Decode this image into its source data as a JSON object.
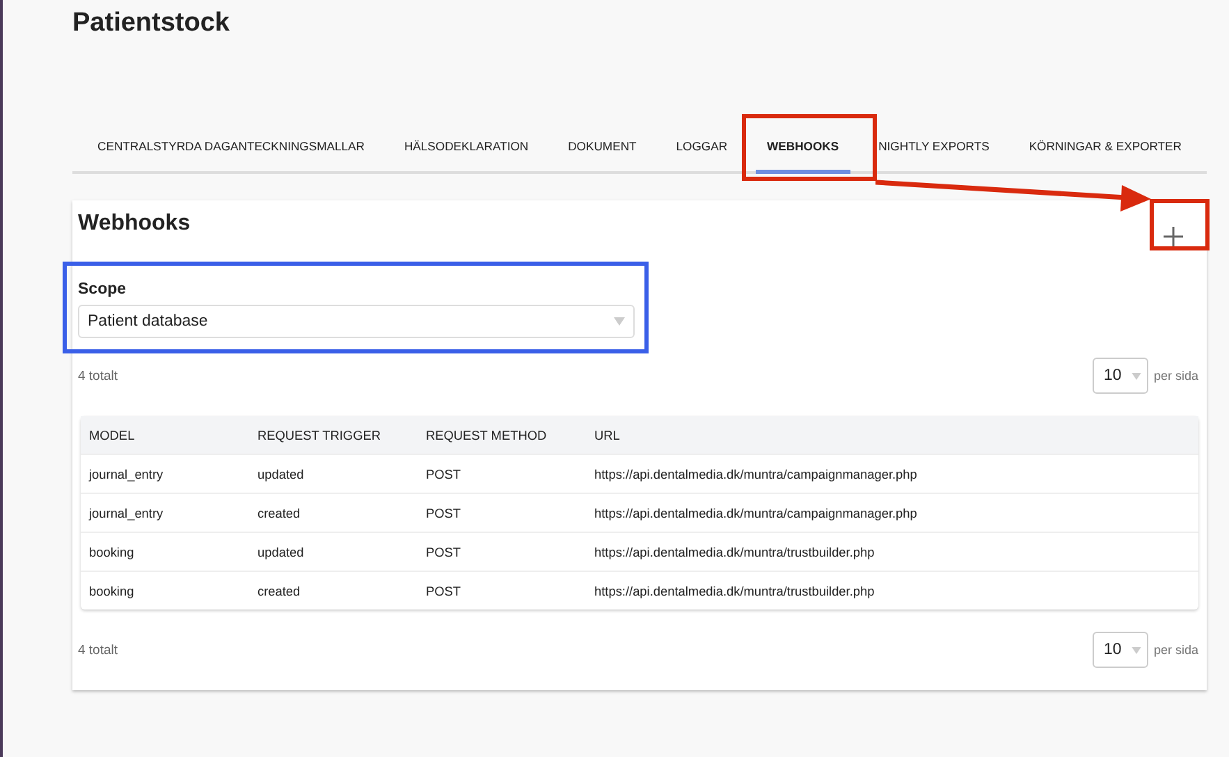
{
  "page_title": "Patientstock",
  "tabs": [
    {
      "label": "CENTRALSTYRDA DAGANTECKNINGSMALLAR",
      "selected": false
    },
    {
      "label": "HÄLSODEKLARATION",
      "selected": false
    },
    {
      "label": "DOKUMENT",
      "selected": false
    },
    {
      "label": "LOGGAR",
      "selected": false
    },
    {
      "label": "WEBHOOKS",
      "selected": true
    },
    {
      "label": "NIGHTLY EXPORTS",
      "selected": false
    },
    {
      "label": "KÖRNINGAR & EXPORTER",
      "selected": false
    }
  ],
  "card": {
    "title": "Webhooks",
    "scope": {
      "label": "Scope",
      "value": "Patient database"
    },
    "total_top": "4 totalt",
    "per_page_top": {
      "value": "10",
      "label": "per sida"
    },
    "table": {
      "columns": [
        "MODEL",
        "REQUEST TRIGGER",
        "REQUEST METHOD",
        "URL"
      ],
      "rows": [
        [
          "journal_entry",
          "updated",
          "POST",
          "https://api.dentalmedia.dk/muntra/campaignmanager.php"
        ],
        [
          "journal_entry",
          "created",
          "POST",
          "https://api.dentalmedia.dk/muntra/campaignmanager.php"
        ],
        [
          "booking",
          "updated",
          "POST",
          "https://api.dentalmedia.dk/muntra/trustbuilder.php"
        ],
        [
          "booking",
          "created",
          "POST",
          "https://api.dentalmedia.dk/muntra/trustbuilder.php"
        ]
      ]
    },
    "total_bottom": "4 totalt",
    "per_page_bottom": {
      "value": "10",
      "label": "per sida"
    }
  }
}
